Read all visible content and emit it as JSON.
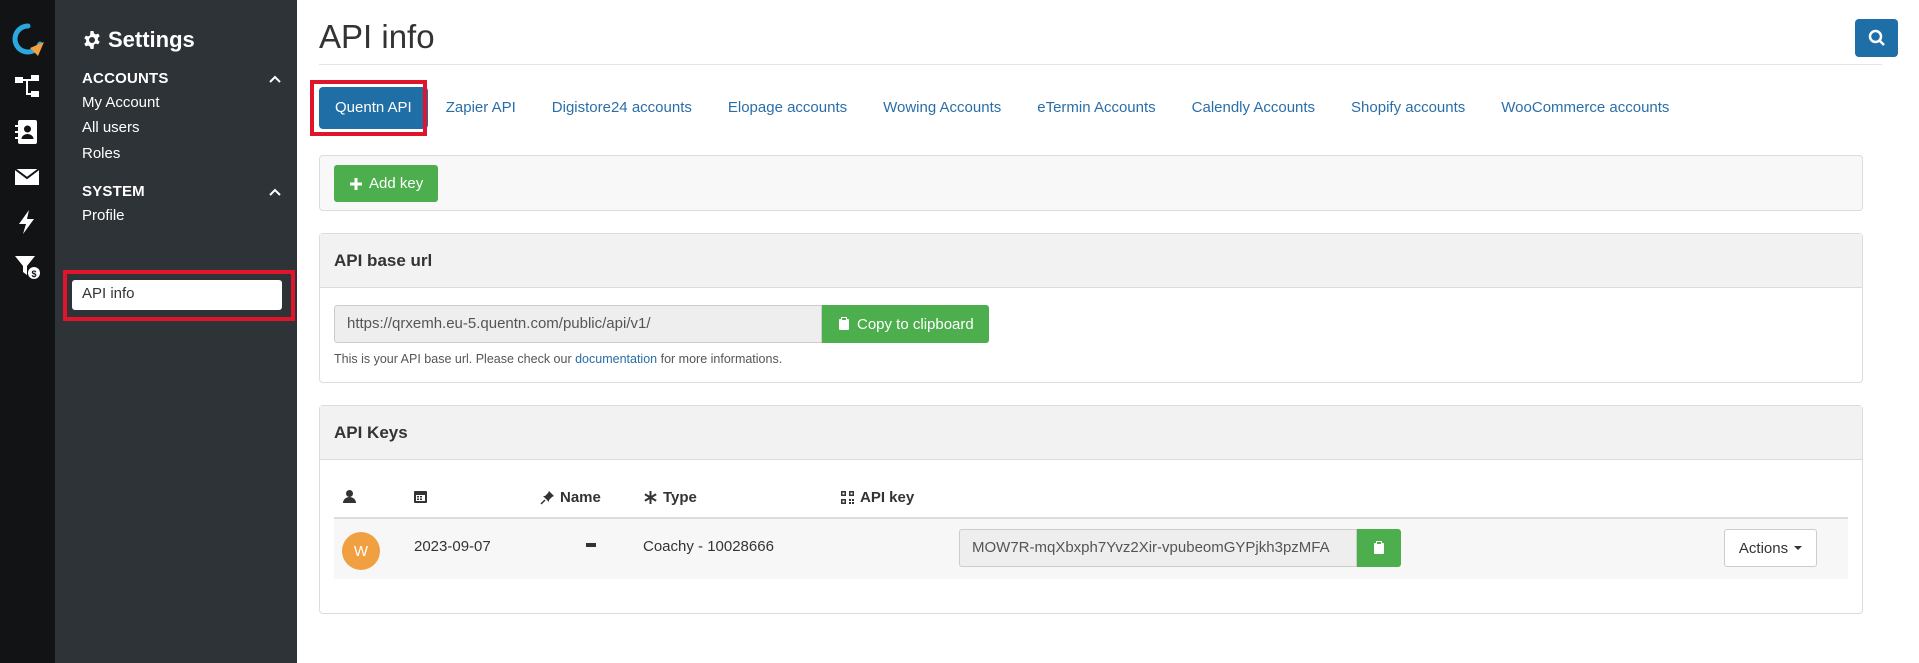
{
  "rail": {
    "items": [
      "logo-icon",
      "funnel-tree-icon",
      "contacts-icon",
      "mail-icon",
      "bolt-icon",
      "filter-money-icon"
    ]
  },
  "sidebar": {
    "title": "Settings",
    "accounts": {
      "heading": "ACCOUNTS",
      "items": [
        "My Account",
        "All users",
        "Roles"
      ]
    },
    "system": {
      "heading": "SYSTEM",
      "items": [
        "Profile",
        "API info"
      ]
    },
    "active_item": "API info"
  },
  "page": {
    "title": "API info"
  },
  "tabs": [
    {
      "label": "Quentn API",
      "active": true
    },
    {
      "label": "Zapier API"
    },
    {
      "label": "Digistore24 accounts"
    },
    {
      "label": "Elopage accounts"
    },
    {
      "label": "Wowing Accounts"
    },
    {
      "label": "eTermin Accounts"
    },
    {
      "label": "Calendly Accounts"
    },
    {
      "label": "Shopify accounts"
    },
    {
      "label": "WooCommerce accounts"
    }
  ],
  "toolbar": {
    "add_key_label": "Add key"
  },
  "base_url": {
    "heading": "API base url",
    "value": "https://qrxemh.eu-5.quentn.com/public/api/v1/",
    "copy_label": "Copy to clipboard",
    "help_prefix": "This is your API base url. Please check our",
    "help_link": "documentation",
    "help_suffix": "for more informations."
  },
  "api_keys": {
    "heading": "API Keys",
    "columns": {
      "name": "Name",
      "type": "Type",
      "api_key": "API key"
    },
    "rows": [
      {
        "avatar": "W",
        "date": "2023-09-07",
        "type": "Coachy - 10028666",
        "api_key": "MOW7R-mqXbxph7Yvz2Xir-vpubeomGYPjkh3pzMFA",
        "actions_label": "Actions"
      }
    ]
  },
  "colors": {
    "primary": "#1f6fa6",
    "success": "#4cae4c",
    "highlight": "#e0142a",
    "avatar": "#f0a040"
  }
}
